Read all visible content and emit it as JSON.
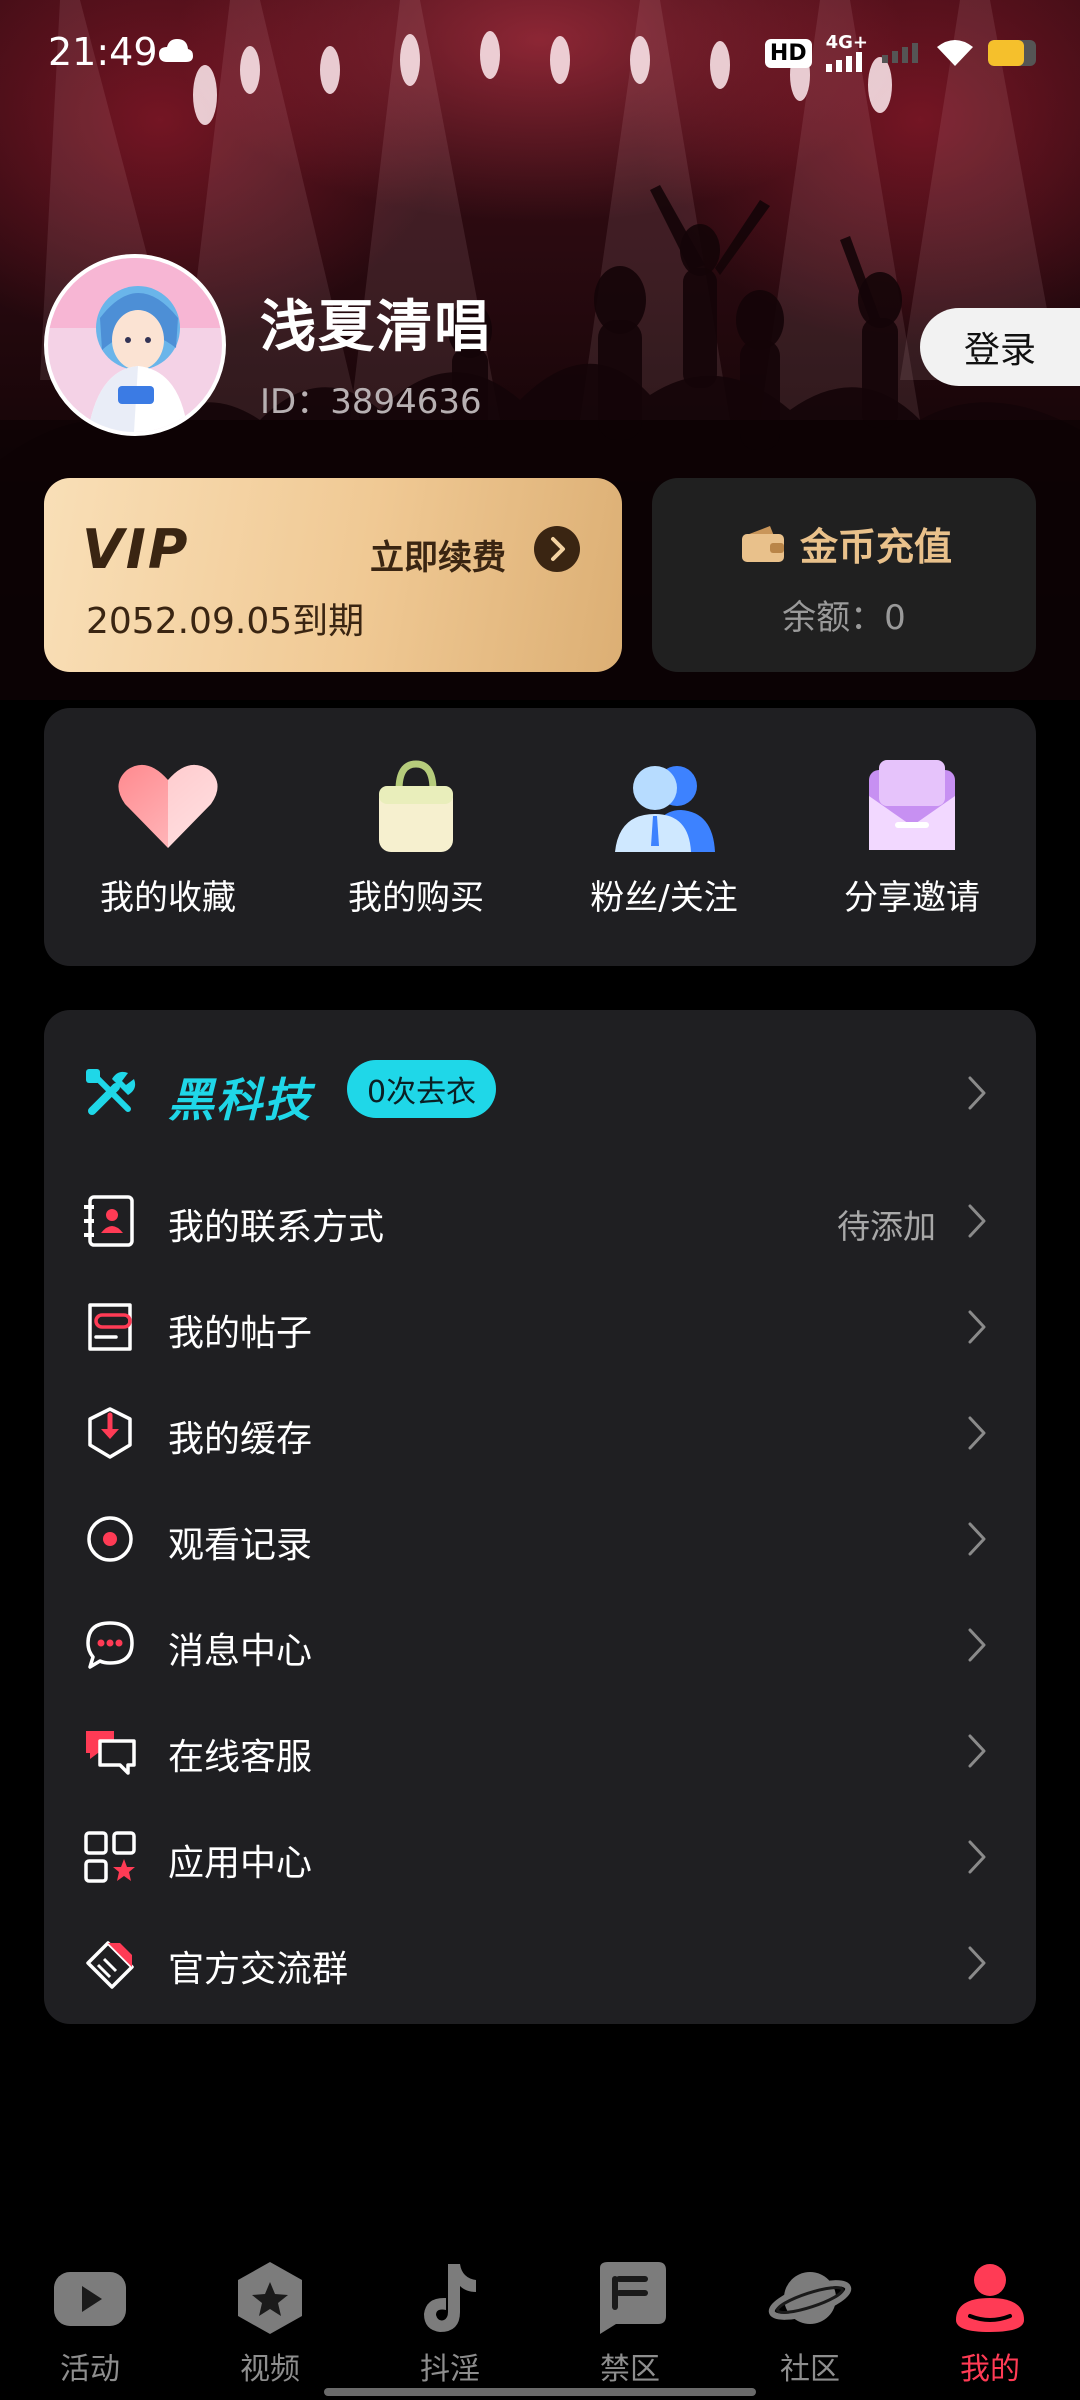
{
  "status_bar": {
    "time": "21:49",
    "hd": "HD",
    "network": "4G+",
    "battery_level": 0.75,
    "battery_color": "#f5c02c"
  },
  "profile": {
    "username": "浅夏清唱",
    "user_id": "ID：3894636",
    "login_label": "登录"
  },
  "vip": {
    "logo": "VIP",
    "renew_label": "立即续费",
    "expire": "2052.09.05到期"
  },
  "coin": {
    "title": "金币充值",
    "balance": "余额：0"
  },
  "quick_actions": [
    {
      "label": "我的收藏",
      "icon": "heart-icon"
    },
    {
      "label": "我的购买",
      "icon": "shopping-bag-icon"
    },
    {
      "label": "粉丝/关注",
      "icon": "users-icon"
    },
    {
      "label": "分享邀请",
      "icon": "envelope-icon"
    }
  ],
  "black_tech": {
    "title": "黑科技",
    "badge": "0次去衣"
  },
  "menu": [
    {
      "label": "我的联系方式",
      "value": "待添加",
      "icon": "contact-book-icon"
    },
    {
      "label": "我的帖子",
      "value": "",
      "icon": "post-icon"
    },
    {
      "label": "我的缓存",
      "value": "",
      "icon": "download-cache-icon"
    },
    {
      "label": "观看记录",
      "value": "",
      "icon": "history-icon"
    },
    {
      "label": "消息中心",
      "value": "",
      "icon": "message-icon"
    },
    {
      "label": "在线客服",
      "value": "",
      "icon": "chat-support-icon"
    },
    {
      "label": "应用中心",
      "value": "",
      "icon": "app-grid-icon"
    },
    {
      "label": "官方交流群",
      "value": "",
      "icon": "group-icon"
    }
  ],
  "bottom_nav": [
    {
      "label": "活动",
      "icon": "play-icon",
      "active": false
    },
    {
      "label": "视频",
      "icon": "star-hexagon-icon",
      "active": false
    },
    {
      "label": "抖淫",
      "icon": "music-note-icon",
      "active": false
    },
    {
      "label": "禁区",
      "icon": "book-icon",
      "active": false
    },
    {
      "label": "社区",
      "icon": "planet-icon",
      "active": false
    },
    {
      "label": "我的",
      "icon": "person-icon",
      "active": true
    }
  ],
  "colors": {
    "accent_active": "#ff3b55",
    "black_tech": "#1fd7e8",
    "vip_gold": "#f0c994",
    "coin_gold": "#e9c18b"
  }
}
